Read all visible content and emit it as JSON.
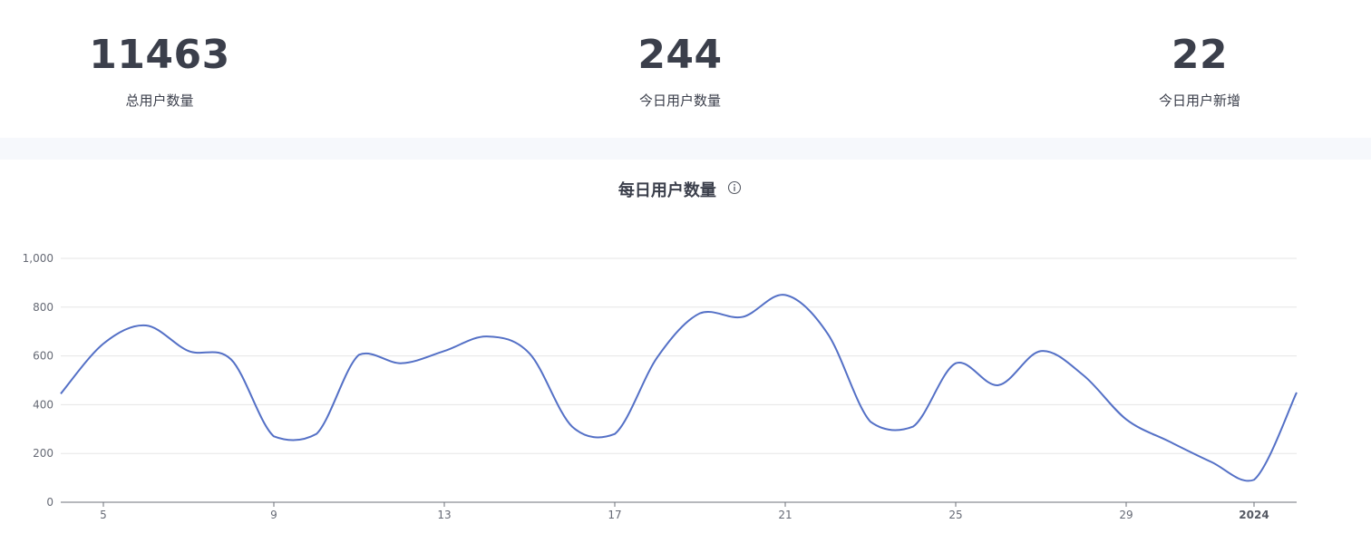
{
  "stats": [
    {
      "value": "11463",
      "label": "总用户数量"
    },
    {
      "value": "244",
      "label": "今日用户数量"
    },
    {
      "value": "22",
      "label": "今日用户新增"
    }
  ],
  "chart_title": "每日用户数量",
  "colors": {
    "line": "#5470c6",
    "grid": "#e6e6e6",
    "axis": "#6e7079",
    "divider_band": "#f6f8fc",
    "text": "#3b3f4b"
  },
  "chart_data": {
    "type": "line",
    "title": "每日用户数量",
    "xlabel": "",
    "ylabel": "",
    "ylim": [
      0,
      1000
    ],
    "y_ticks": [
      0,
      200,
      400,
      600,
      800,
      1000
    ],
    "y_tick_labels": [
      "0",
      "200",
      "400",
      "600",
      "800",
      "1,000"
    ],
    "x_range": [
      "2023-12-04",
      "2024-01-02"
    ],
    "x_ticks": [
      {
        "date": "2023-12-05",
        "label": "5",
        "bold": false
      },
      {
        "date": "2023-12-09",
        "label": "9",
        "bold": false
      },
      {
        "date": "2023-12-13",
        "label": "13",
        "bold": false
      },
      {
        "date": "2023-12-17",
        "label": "17",
        "bold": false
      },
      {
        "date": "2023-12-21",
        "label": "21",
        "bold": false
      },
      {
        "date": "2023-12-25",
        "label": "25",
        "bold": false
      },
      {
        "date": "2023-12-29",
        "label": "29",
        "bold": false
      },
      {
        "date": "2024-01-01",
        "label": "2024",
        "bold": true
      }
    ],
    "grid": true,
    "smooth": true,
    "series": [
      {
        "x": [
          "2023-12-04",
          "2023-12-05",
          "2023-12-06",
          "2023-12-07",
          "2023-12-08",
          "2023-12-09",
          "2023-12-10",
          "2023-12-11",
          "2023-12-12",
          "2023-12-13",
          "2023-12-14",
          "2023-12-15",
          "2023-12-16",
          "2023-12-17",
          "2023-12-18",
          "2023-12-19",
          "2023-12-20",
          "2023-12-21",
          "2023-12-22",
          "2023-12-23",
          "2023-12-24",
          "2023-12-25",
          "2023-12-26",
          "2023-12-27",
          "2023-12-28",
          "2023-12-29",
          "2023-12-30",
          "2023-12-31",
          "2024-01-01",
          "2024-01-02"
        ],
        "values": [
          445,
          650,
          725,
          620,
          585,
          270,
          280,
          605,
          570,
          620,
          680,
          610,
          310,
          280,
          595,
          775,
          760,
          850,
          690,
          330,
          310,
          570,
          480,
          620,
          520,
          340,
          250,
          165,
          92,
          450
        ]
      }
    ]
  }
}
